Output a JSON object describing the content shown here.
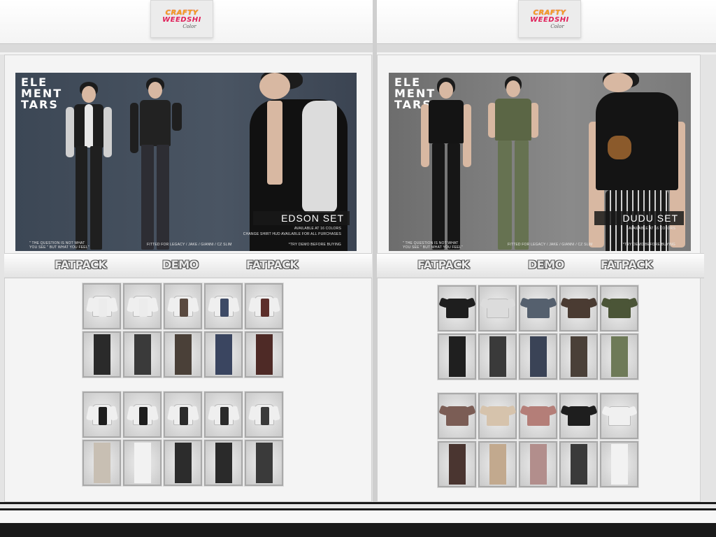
{
  "signs": [
    {
      "line1": "CRAFTY",
      "line2": "WEEDSHI",
      "line3": "Color"
    },
    {
      "line1": "CRAFTY",
      "line2": "WEEDSHI",
      "line3": "Color"
    }
  ],
  "left": {
    "brand": [
      "ELE",
      "MENT",
      "TARS"
    ],
    "set_name": "EDSON SET",
    "sub1": "AVAILABLE AT 16 COLORS",
    "sub2": "CHANGE SHIRT HUD AVAILABLE FOR ALL PURCHASES",
    "fine_left": "\" THE QUESTION IS NOT WHAT YOU SEE \" BUT WHAT YOU FEEL\"",
    "fine_mid": "FITTED FOR LEGACY / JAKE / GIANNI / CZ SLIM",
    "fine_right": "*TRY DEMO BEFORE BUYING",
    "buttons": [
      "FATPACK",
      "DEMO",
      "FATPACK"
    ]
  },
  "right": {
    "brand": [
      "ELE",
      "MENT",
      "TARS"
    ],
    "set_name": "DUDU SET",
    "sub1": "AVAILABLE AT 16 COLORS",
    "fine_left": "\" THE QUESTION IS NOT WHAT YOU SEE \" BUT WHAT YOU FEEL\"",
    "fine_mid": "FITTED FOR LEGACY / JAKE / GIANNI / CZ SLIM",
    "fine_right": "*TRY DEMO BEFORE BUYING",
    "buttons": [
      "FATPACK",
      "DEMO",
      "FATPACK"
    ]
  },
  "colors": {
    "left_top_vests": [
      "#ececec",
      "#ececec",
      "#5a4a40",
      "#3d4a66",
      "#5c2e2a"
    ],
    "left_top_pants": [
      "#2a2a2a",
      "#3a3a3a",
      "#4a4038",
      "#3a4560",
      "#4e2a26"
    ],
    "left_bottom_vests": [
      "#1e1e1e",
      "#1e1e1e",
      "#2b2b2b",
      "#2b2b2b",
      "#3a3a3a"
    ],
    "left_bottom_pants": [
      "#c8bfb3",
      "#f2f2f2",
      "#2c2c2c",
      "#2a2a2a",
      "#3a3a3a"
    ],
    "right_top_tees": [
      "#1e1e1e",
      "#dcdcdc",
      "#55606e",
      "#4a3b32",
      "#4b5537"
    ],
    "right_top_pants": [
      "#1f1f1f",
      "#3a3a3a",
      "#3a4356",
      "#4a4038",
      "#6e7a58"
    ],
    "right_bottom_tees": [
      "#7b5d55",
      "#d6c3ac",
      "#b47e78",
      "#1e1e1e",
      "#f0f0f0"
    ],
    "right_bottom_pants": [
      "#4a3530",
      "#c2a98e",
      "#b28e8c",
      "#3a3a3a",
      "#f2f2f2"
    ]
  }
}
